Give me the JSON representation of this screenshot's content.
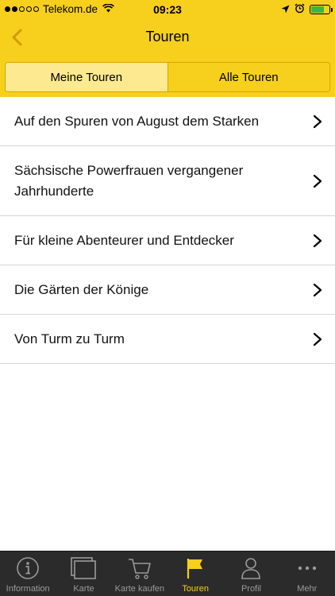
{
  "status_bar": {
    "carrier": "Telekom.de",
    "time": "09:23",
    "signal_dots_filled": 2,
    "signal_dots_total": 5,
    "battery_level": 0.72
  },
  "navbar": {
    "title": "Touren",
    "back_icon": "chevron-left-icon"
  },
  "segments": {
    "items": [
      {
        "label": "Meine Touren",
        "selected": false
      },
      {
        "label": "Alle Touren",
        "selected": true
      }
    ]
  },
  "tours": [
    {
      "label": "Auf den Spuren von August dem Starken"
    },
    {
      "label": "Sächsische Powerfrauen vergangener Jahrhunderte"
    },
    {
      "label": "Für kleine Abenteurer und Entdecker"
    },
    {
      "label": "Die Gärten der Könige"
    },
    {
      "label": "Von Turm zu Turm"
    }
  ],
  "tabbar": {
    "items": [
      {
        "label": "Information",
        "icon": "info-icon",
        "active": false
      },
      {
        "label": "Karte",
        "icon": "card-icon",
        "active": false
      },
      {
        "label": "Karte kaufen",
        "icon": "cart-icon",
        "active": false
      },
      {
        "label": "Touren",
        "icon": "flag-icon",
        "active": true
      },
      {
        "label": "Profil",
        "icon": "person-icon",
        "active": false
      },
      {
        "label": "Mehr",
        "icon": "more-icon",
        "active": false
      }
    ]
  },
  "colors": {
    "accent": "#f7cf1d",
    "segment_inactive": "#fde98f",
    "tabbar_bg": "#2b2b2b",
    "tab_inactive": "#9a9a9a"
  }
}
